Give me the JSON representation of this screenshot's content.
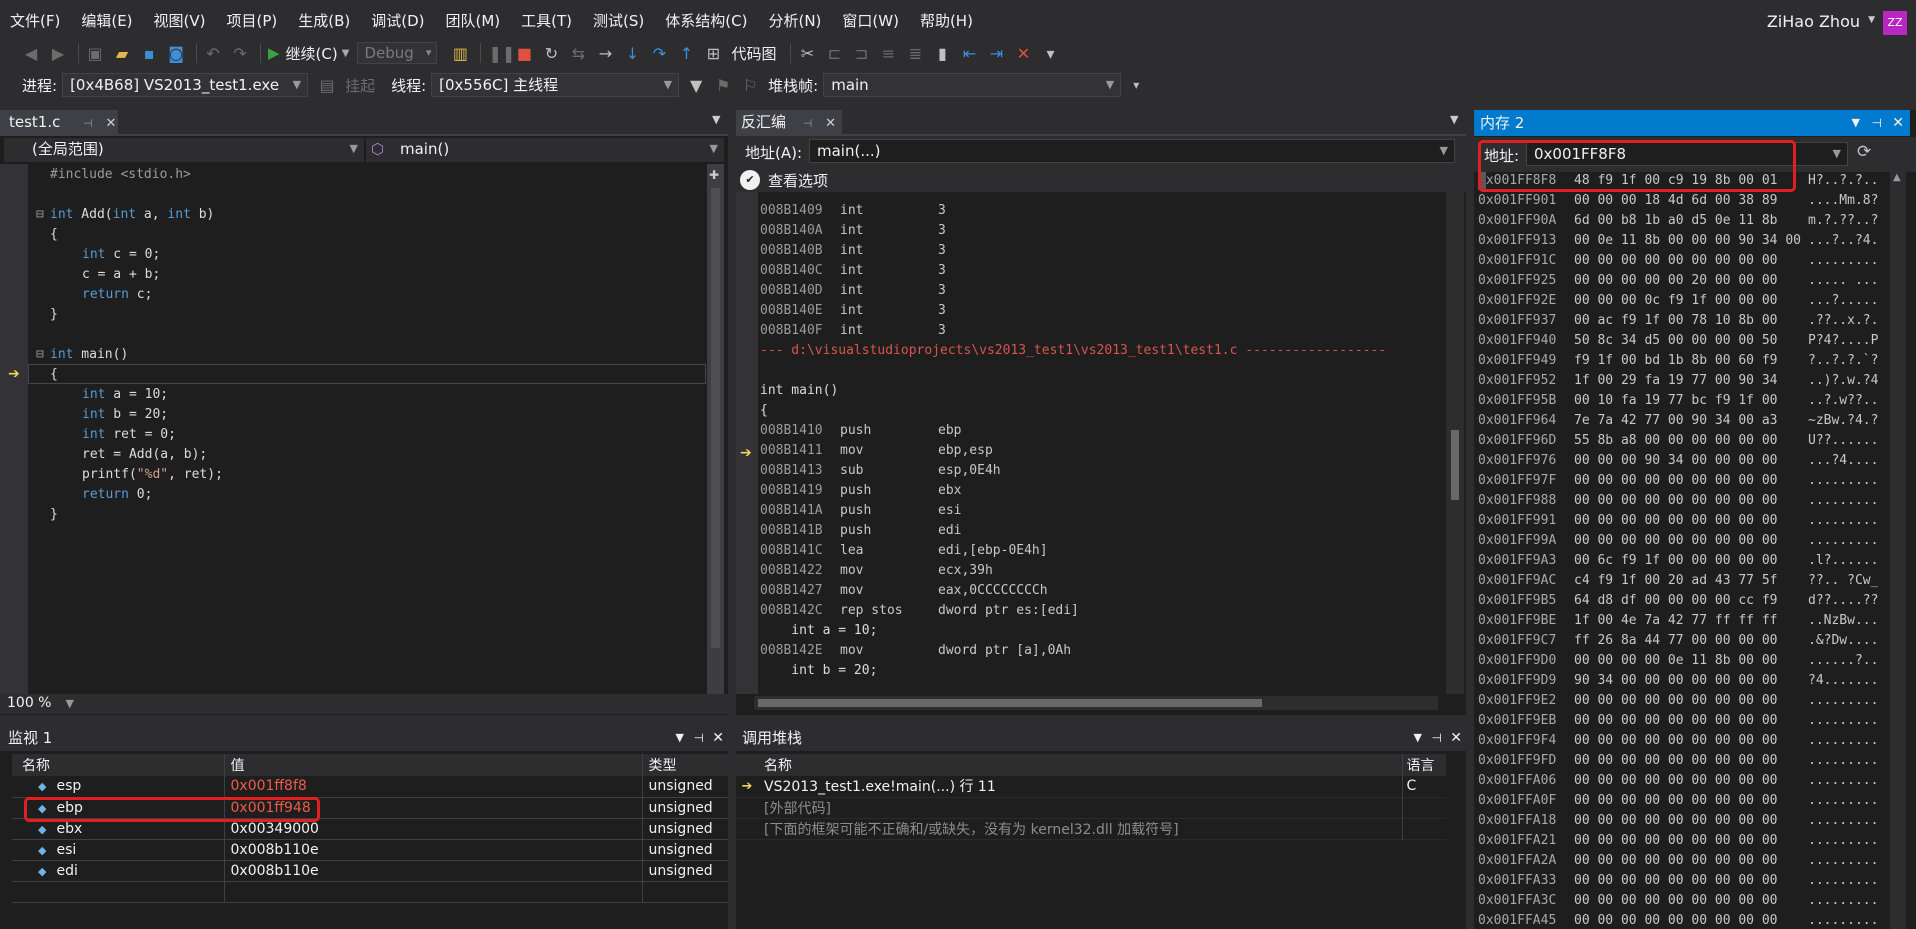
{
  "menu": [
    "文件(F)",
    "编辑(E)",
    "视图(V)",
    "项目(P)",
    "生成(B)",
    "调试(D)",
    "团队(M)",
    "工具(T)",
    "测试(S)",
    "体系结构(C)",
    "分析(N)",
    "窗口(W)",
    "帮助(H)"
  ],
  "user": {
    "name": "ZiHao Zhou",
    "initials": "ZZ"
  },
  "toolbar": {
    "continue_label": "继续(C)",
    "config": "Debug",
    "codemap_label": "代码图"
  },
  "debugbar": {
    "process_label": "进程:",
    "process_value": "[0x4B68] VS2013_test1.exe",
    "suspend_label": "挂起",
    "thread_label": "线程:",
    "thread_value": "[0x556C] 主线程",
    "stackframe_label": "堆栈帧:",
    "stackframe_value": "main"
  },
  "editor": {
    "tab": "test1.c",
    "scope": "(全局范围)",
    "function": "main()",
    "zoom": "100 %",
    "lines": [
      {
        "fold": "",
        "indent": 0,
        "parts": [
          [
            "inc",
            "#include <stdio.h>"
          ]
        ]
      },
      {
        "fold": "",
        "indent": 0,
        "parts": []
      },
      {
        "fold": "⊟",
        "indent": 0,
        "parts": [
          [
            "kw",
            "int"
          ],
          [
            "txt",
            " Add("
          ],
          [
            "kw",
            "int"
          ],
          [
            "txt",
            " a, "
          ],
          [
            "kw",
            "int"
          ],
          [
            "txt",
            " b)"
          ]
        ]
      },
      {
        "fold": "",
        "indent": 0,
        "parts": [
          [
            "txt",
            "{"
          ]
        ]
      },
      {
        "fold": "",
        "indent": 1,
        "parts": [
          [
            "kw",
            "int"
          ],
          [
            "txt",
            " c = 0;"
          ]
        ]
      },
      {
        "fold": "",
        "indent": 1,
        "parts": [
          [
            "txt",
            "c = a + b;"
          ]
        ]
      },
      {
        "fold": "",
        "indent": 1,
        "parts": [
          [
            "kw",
            "return"
          ],
          [
            "txt",
            " c;"
          ]
        ]
      },
      {
        "fold": "",
        "indent": 0,
        "parts": [
          [
            "txt",
            "}"
          ]
        ]
      },
      {
        "fold": "",
        "indent": 0,
        "parts": []
      },
      {
        "fold": "⊟",
        "indent": 0,
        "parts": [
          [
            "kw",
            "int"
          ],
          [
            "txt",
            " main()"
          ]
        ]
      },
      {
        "fold": "",
        "indent": 0,
        "parts": [
          [
            "txt",
            "{"
          ]
        ]
      },
      {
        "fold": "",
        "indent": 1,
        "parts": [
          [
            "kw",
            "int"
          ],
          [
            "txt",
            " a = 10;"
          ]
        ]
      },
      {
        "fold": "",
        "indent": 1,
        "parts": [
          [
            "kw",
            "int"
          ],
          [
            "txt",
            " b = 20;"
          ]
        ]
      },
      {
        "fold": "",
        "indent": 1,
        "parts": [
          [
            "kw",
            "int"
          ],
          [
            "txt",
            " ret = 0;"
          ]
        ]
      },
      {
        "fold": "",
        "indent": 1,
        "parts": [
          [
            "txt",
            "ret = Add(a, b);"
          ]
        ]
      },
      {
        "fold": "",
        "indent": 1,
        "parts": [
          [
            "txt",
            "printf("
          ],
          [
            "str",
            "\"%d\""
          ],
          [
            "txt",
            ", ret);"
          ]
        ]
      },
      {
        "fold": "",
        "indent": 1,
        "parts": [
          [
            "kw",
            "return"
          ],
          [
            "txt",
            " 0;"
          ]
        ]
      },
      {
        "fold": "",
        "indent": 0,
        "parts": [
          [
            "txt",
            "}"
          ]
        ]
      }
    ]
  },
  "disasm": {
    "tab": "反汇编",
    "address_label": "地址(A):",
    "address_value": "main(...)",
    "view_options": "查看选项",
    "rows": [
      {
        "a": "008B1409",
        "m": "int",
        "o": "3"
      },
      {
        "a": "008B140A",
        "m": "int",
        "o": "3"
      },
      {
        "a": "008B140B",
        "m": "int",
        "o": "3"
      },
      {
        "a": "008B140C",
        "m": "int",
        "o": "3"
      },
      {
        "a": "008B140D",
        "m": "int",
        "o": "3"
      },
      {
        "a": "008B140E",
        "m": "int",
        "o": "3"
      },
      {
        "a": "008B140F",
        "m": "int",
        "o": "3"
      },
      {
        "src": "--- d:\\visualstudioprojects\\vs2013_test1\\vs2013_test1\\test1.c ------------------",
        "red": true
      },
      {
        "src": ""
      },
      {
        "src": "int main()"
      },
      {
        "src": "{"
      },
      {
        "a": "008B1410",
        "m": "push",
        "o": "ebp"
      },
      {
        "a": "008B1411",
        "m": "mov",
        "o": "ebp,esp"
      },
      {
        "a": "008B1413",
        "m": "sub",
        "o": "esp,0E4h"
      },
      {
        "a": "008B1419",
        "m": "push",
        "o": "ebx"
      },
      {
        "a": "008B141A",
        "m": "push",
        "o": "esi"
      },
      {
        "a": "008B141B",
        "m": "push",
        "o": "edi"
      },
      {
        "a": "008B141C",
        "m": "lea",
        "o": "edi,[ebp-0E4h]"
      },
      {
        "a": "008B1422",
        "m": "mov",
        "o": "ecx,39h"
      },
      {
        "a": "008B1427",
        "m": "mov",
        "o": "eax,0CCCCCCCCh"
      },
      {
        "a": "008B142C",
        "m": "rep stos",
        "o": "dword ptr es:[edi]"
      },
      {
        "src": "    int a = 10;"
      },
      {
        "a": "008B142E",
        "m": "mov",
        "o": "dword ptr [a],0Ah"
      },
      {
        "src": "    int b = 20;"
      }
    ]
  },
  "memory": {
    "title": "内存 2",
    "address_label": "地址:",
    "address_value": "0x001FF8F8",
    "rows": [
      [
        "0x001FF8F8",
        "48 f9 1f 00 c9 19 8b 00 01",
        "H?..?.?.."
      ],
      [
        "0x001FF901",
        "00 00 00 18 4d 6d 00 38 89",
        "....Mm.8?"
      ],
      [
        "0x001FF90A",
        "6d 00 b8 1b a0 d5 0e 11 8b",
        "m.?.??..?"
      ],
      [
        "0x001FF913",
        "00 0e 11 8b 00 00 00 90 34 00",
        "...?..?4."
      ],
      [
        "0x001FF91C",
        "00 00 00 00 00 00 00 00 00",
        "........."
      ],
      [
        "0x001FF925",
        "00 00 00 00 00 20 00 00 00",
        "..... ..."
      ],
      [
        "0x001FF92E",
        "00 00 00 0c f9 1f 00 00 00",
        "...?....."
      ],
      [
        "0x001FF937",
        "00 ac f9 1f 00 78 10 8b 00",
        ".??..x.?."
      ],
      [
        "0x001FF940",
        "50 8c 34 d5 00 00 00 00 50",
        "P?4?....P"
      ],
      [
        "0x001FF949",
        "f9 1f 00 bd 1b 8b 00 60 f9",
        "?..?.?.`?"
      ],
      [
        "0x001FF952",
        "1f 00 29 fa 19 77 00 90 34",
        "..)?.w.?4"
      ],
      [
        "0x001FF95B",
        "00 10 fa 19 77 bc f9 1f 00",
        "..?.w??.."
      ],
      [
        "0x001FF964",
        "7e 7a 42 77 00 90 34 00 a3",
        "~zBw.?4.?"
      ],
      [
        "0x001FF96D",
        "55 8b a8 00 00 00 00 00 00",
        "U??......"
      ],
      [
        "0x001FF976",
        "00 00 00 90 34 00 00 00 00",
        "...?4...."
      ],
      [
        "0x001FF97F",
        "00 00 00 00 00 00 00 00 00",
        "........."
      ],
      [
        "0x001FF988",
        "00 00 00 00 00 00 00 00 00",
        "........."
      ],
      [
        "0x001FF991",
        "00 00 00 00 00 00 00 00 00",
        "........."
      ],
      [
        "0x001FF99A",
        "00 00 00 00 00 00 00 00 00",
        "........."
      ],
      [
        "0x001FF9A3",
        "00 6c f9 1f 00 00 00 00 00",
        ".l?......"
      ],
      [
        "0x001FF9AC",
        "c4 f9 1f 00 20 ad 43 77 5f",
        "??.. ?Cw_"
      ],
      [
        "0x001FF9B5",
        "64 d8 df 00 00 00 00 cc f9",
        "d??....??"
      ],
      [
        "0x001FF9BE",
        "1f 00 4e 7a 42 77 ff ff ff",
        "..NzBw..."
      ],
      [
        "0x001FF9C7",
        "ff 26 8a 44 77 00 00 00 00",
        ".&?Dw...."
      ],
      [
        "0x001FF9D0",
        "00 00 00 00 0e 11 8b 00 00",
        "......?.."
      ],
      [
        "0x001FF9D9",
        "90 34 00 00 00 00 00 00 00",
        "?4......."
      ],
      [
        "0x001FF9E2",
        "00 00 00 00 00 00 00 00 00",
        "........."
      ],
      [
        "0x001FF9EB",
        "00 00 00 00 00 00 00 00 00",
        "........."
      ],
      [
        "0x001FF9F4",
        "00 00 00 00 00 00 00 00 00",
        "........."
      ],
      [
        "0x001FF9FD",
        "00 00 00 00 00 00 00 00 00",
        "........."
      ],
      [
        "0x001FFA06",
        "00 00 00 00 00 00 00 00 00",
        "........."
      ],
      [
        "0x001FFA0F",
        "00 00 00 00 00 00 00 00 00",
        "........."
      ],
      [
        "0x001FFA18",
        "00 00 00 00 00 00 00 00 00",
        "........."
      ],
      [
        "0x001FFA21",
        "00 00 00 00 00 00 00 00 00",
        "........."
      ],
      [
        "0x001FFA2A",
        "00 00 00 00 00 00 00 00 00",
        "........."
      ],
      [
        "0x001FFA33",
        "00 00 00 00 00 00 00 00 00",
        "........."
      ],
      [
        "0x001FFA3C",
        "00 00 00 00 00 00 00 00 00",
        "........."
      ],
      [
        "0x001FFA45",
        "00 00 00 00 00 00 00 00 00",
        "........."
      ]
    ]
  },
  "watch": {
    "title": "监视 1",
    "columns": [
      "名称",
      "值",
      "类型"
    ],
    "rows": [
      {
        "name": "esp",
        "value": "0x001ff8f8",
        "type": "unsigned",
        "red": true
      },
      {
        "name": "ebp",
        "value": "0x001ff948",
        "type": "unsigned",
        "red": true
      },
      {
        "name": "ebx",
        "value": "0x00349000",
        "type": "unsigned",
        "red": false
      },
      {
        "name": "esi",
        "value": "0x008b110e",
        "type": "unsigned",
        "red": false
      },
      {
        "name": "edi",
        "value": "0x008b110e",
        "type": "unsigned",
        "red": false
      }
    ]
  },
  "callstack": {
    "title": "调用堆栈",
    "columns": [
      "名称",
      "语言"
    ],
    "rows": [
      {
        "name": "VS2013_test1.exe!main(...) 行 11",
        "lang": "C",
        "dim": false
      },
      {
        "name": "[外部代码]",
        "lang": "",
        "dim": true
      },
      {
        "name": "[下面的框架可能不正确和/或缺失，没有为 kernel32.dll 加载符号]",
        "lang": "",
        "dim": true
      }
    ]
  },
  "colors": {
    "accent": "#007acc",
    "highlight": "#e02020",
    "keyword": "#569cd6"
  }
}
